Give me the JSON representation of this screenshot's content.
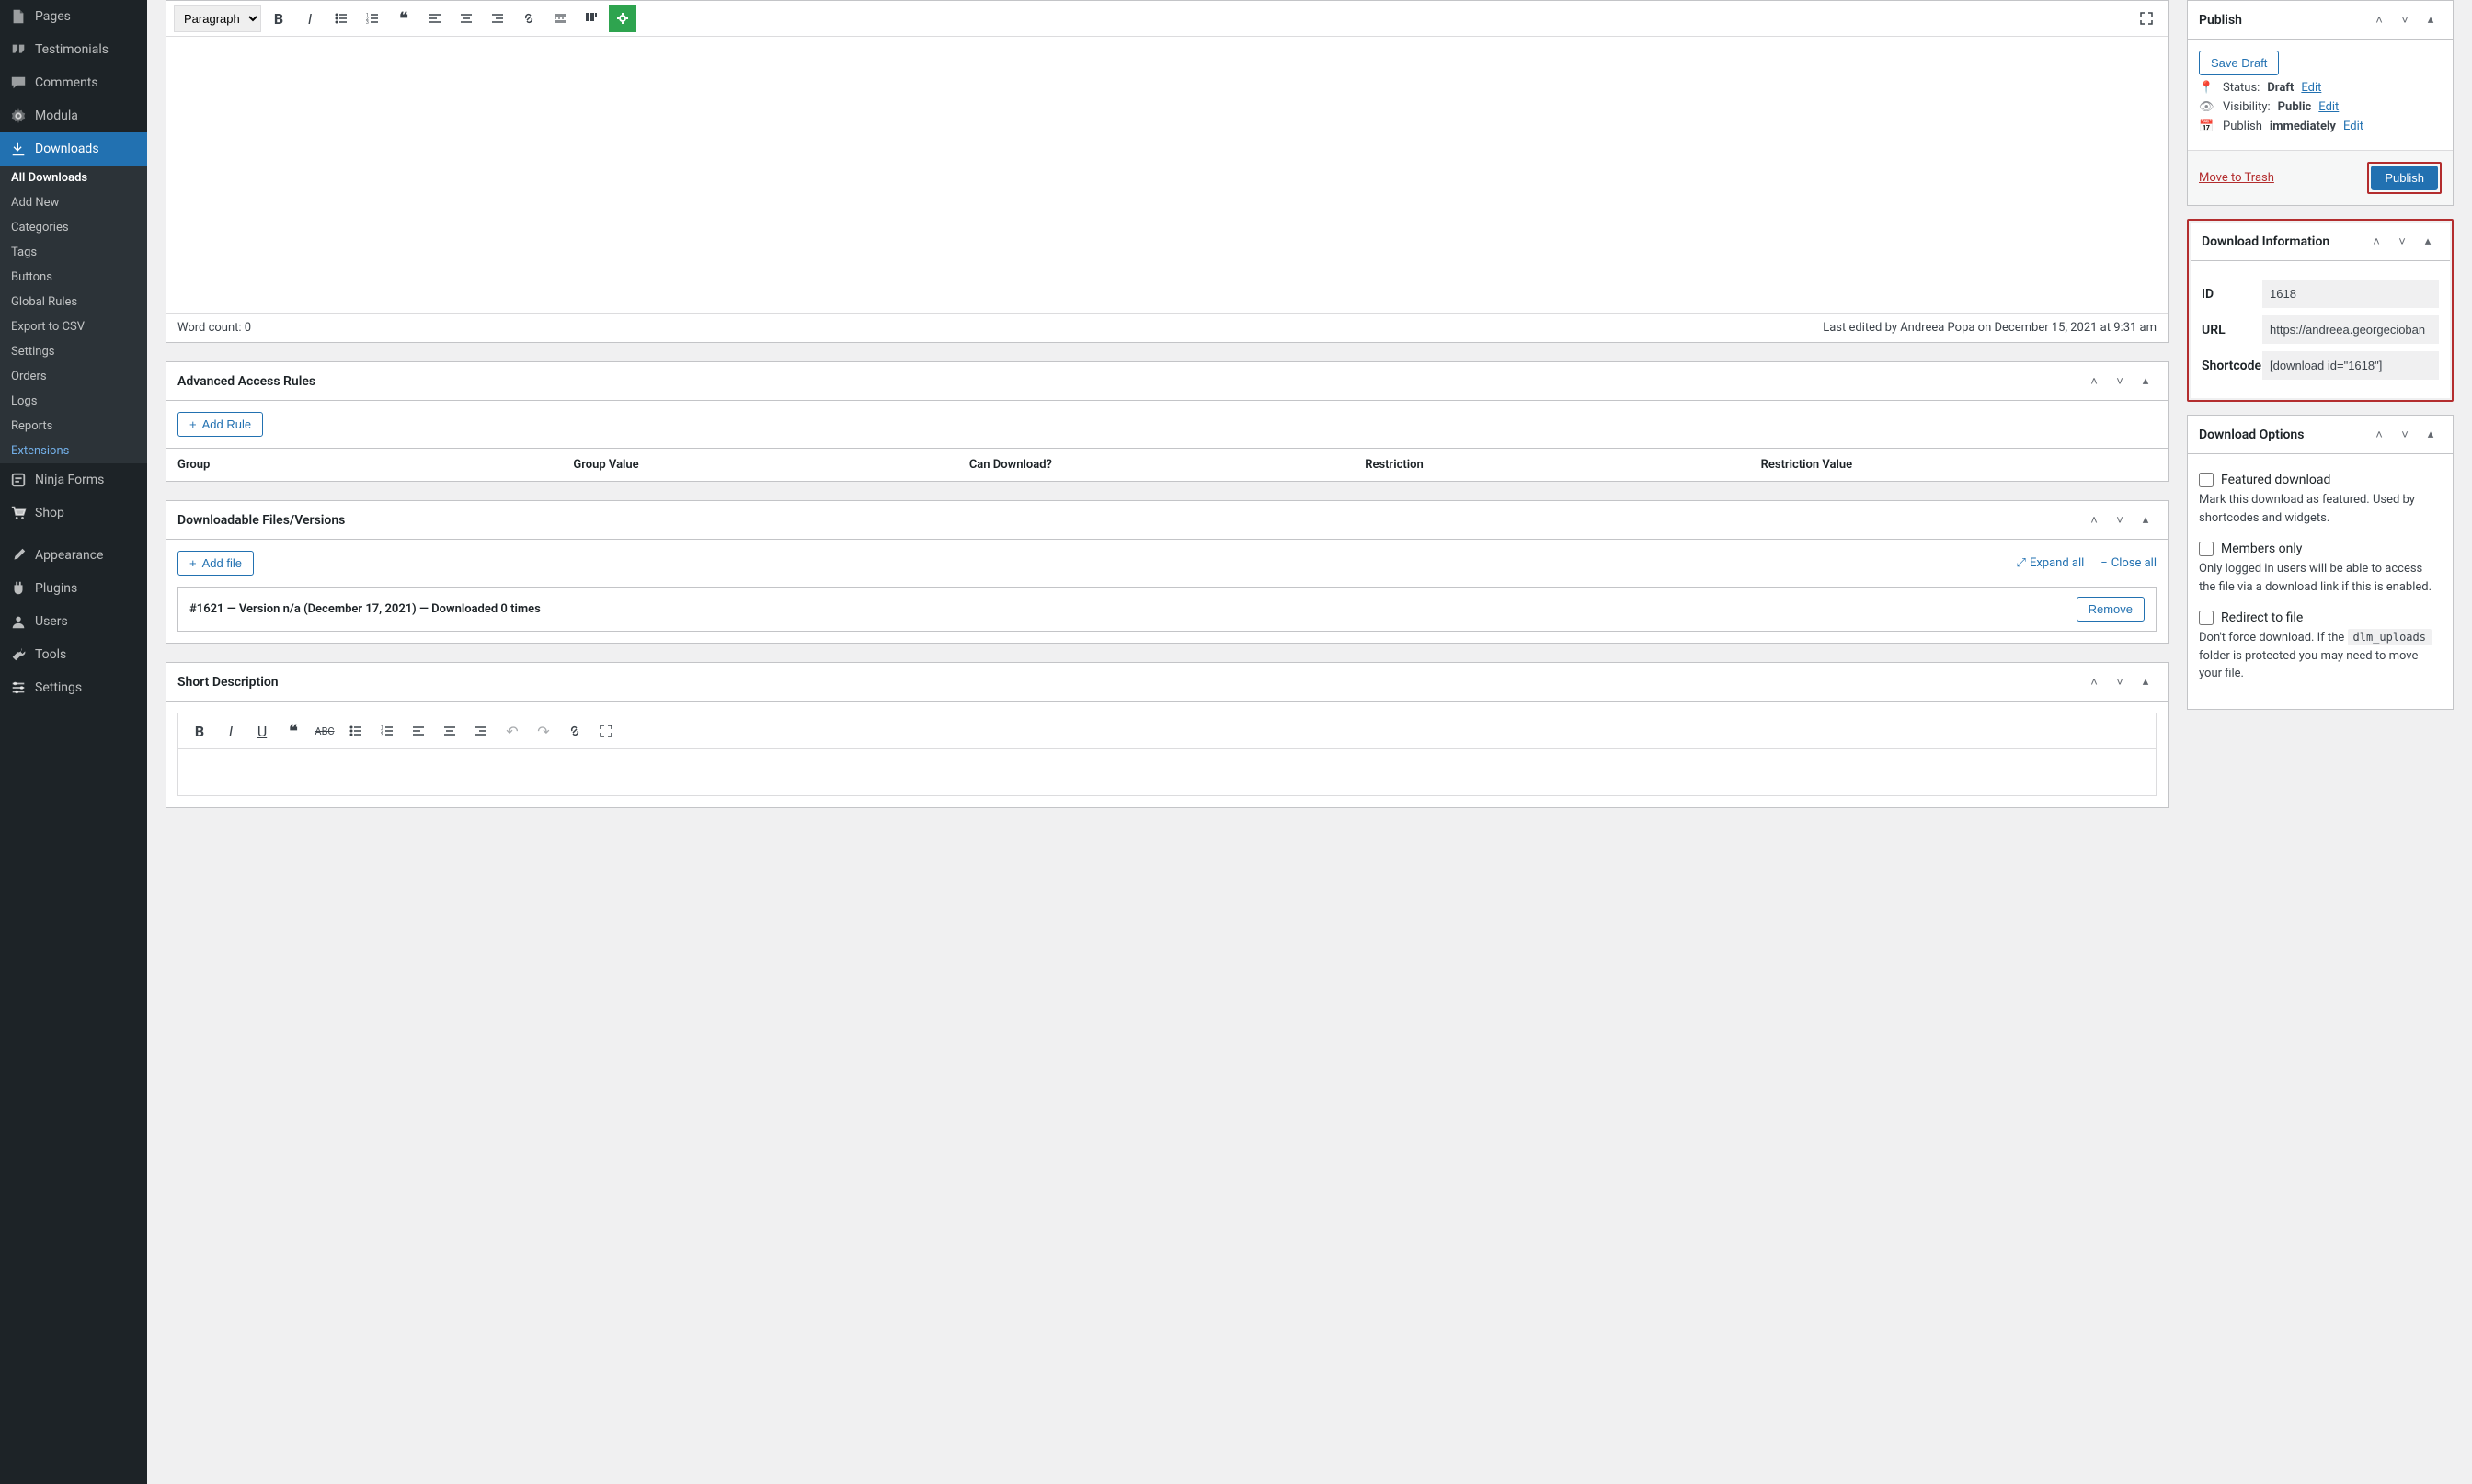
{
  "sidebar": {
    "items": [
      {
        "label": "Pages",
        "icon": "page"
      },
      {
        "label": "Testimonials",
        "icon": "quote"
      },
      {
        "label": "Comments",
        "icon": "comment"
      },
      {
        "label": "Modula",
        "icon": "gear"
      }
    ],
    "active": {
      "label": "Downloads",
      "icon": "download"
    },
    "sub": [
      {
        "label": "All Downloads",
        "current": true
      },
      {
        "label": "Add New"
      },
      {
        "label": "Categories"
      },
      {
        "label": "Tags"
      },
      {
        "label": "Buttons"
      },
      {
        "label": "Global Rules"
      },
      {
        "label": "Export to CSV"
      },
      {
        "label": "Settings"
      },
      {
        "label": "Orders"
      },
      {
        "label": "Logs"
      },
      {
        "label": "Reports"
      },
      {
        "label": "Extensions",
        "highlight": true
      }
    ],
    "after": [
      {
        "label": "Ninja Forms",
        "icon": "form"
      },
      {
        "label": "Shop",
        "icon": "cart"
      },
      {
        "label": "Appearance",
        "icon": "brush"
      },
      {
        "label": "Plugins",
        "icon": "plug"
      },
      {
        "label": "Users",
        "icon": "user"
      },
      {
        "label": "Tools",
        "icon": "wrench"
      },
      {
        "label": "Settings",
        "icon": "sliders"
      }
    ]
  },
  "editor": {
    "format": "Paragraph",
    "word_count_label": "Word count: 0",
    "last_edited": "Last edited by Andreea Popa on December 15, 2021 at 9:31 am"
  },
  "access_rules": {
    "title": "Advanced Access Rules",
    "add_rule": "Add Rule",
    "cols": [
      "Group",
      "Group Value",
      "Can Download?",
      "Restriction",
      "Restriction Value"
    ]
  },
  "files": {
    "title": "Downloadable Files/Versions",
    "add_file": "Add file",
    "expand_all": "Expand all",
    "close_all": "Close all",
    "row": "#1621 — Version n/a (December 17, 2021) — Downloaded 0 times",
    "remove": "Remove"
  },
  "short_desc": {
    "title": "Short Description"
  },
  "publish": {
    "title": "Publish",
    "save_draft": "Save Draft",
    "status_label": "Status:",
    "status_value": "Draft",
    "visibility_label": "Visibility:",
    "visibility_value": "Public",
    "publish_label": "Publish",
    "publish_value": "immediately",
    "edit": "Edit",
    "move_trash": "Move to Trash",
    "publish_btn": "Publish"
  },
  "dl_info": {
    "title": "Download Information",
    "id_label": "ID",
    "id_value": "1618",
    "url_label": "URL",
    "url_value": "https://andreea.georgecioban",
    "shortcode_label": "Shortcode",
    "shortcode_value": "[download id=\"1618\"]"
  },
  "dl_options": {
    "title": "Download Options",
    "featured_label": "Featured download",
    "featured_desc": "Mark this download as featured. Used by shortcodes and widgets.",
    "members_label": "Members only",
    "members_desc": "Only logged in users will be able to access the file via a download link if this is enabled.",
    "redirect_label": "Redirect to file",
    "redirect_desc1": "Don't force download. If the ",
    "redirect_code": "dlm_uploads",
    "redirect_desc2": " folder is protected you may need to move your file."
  }
}
